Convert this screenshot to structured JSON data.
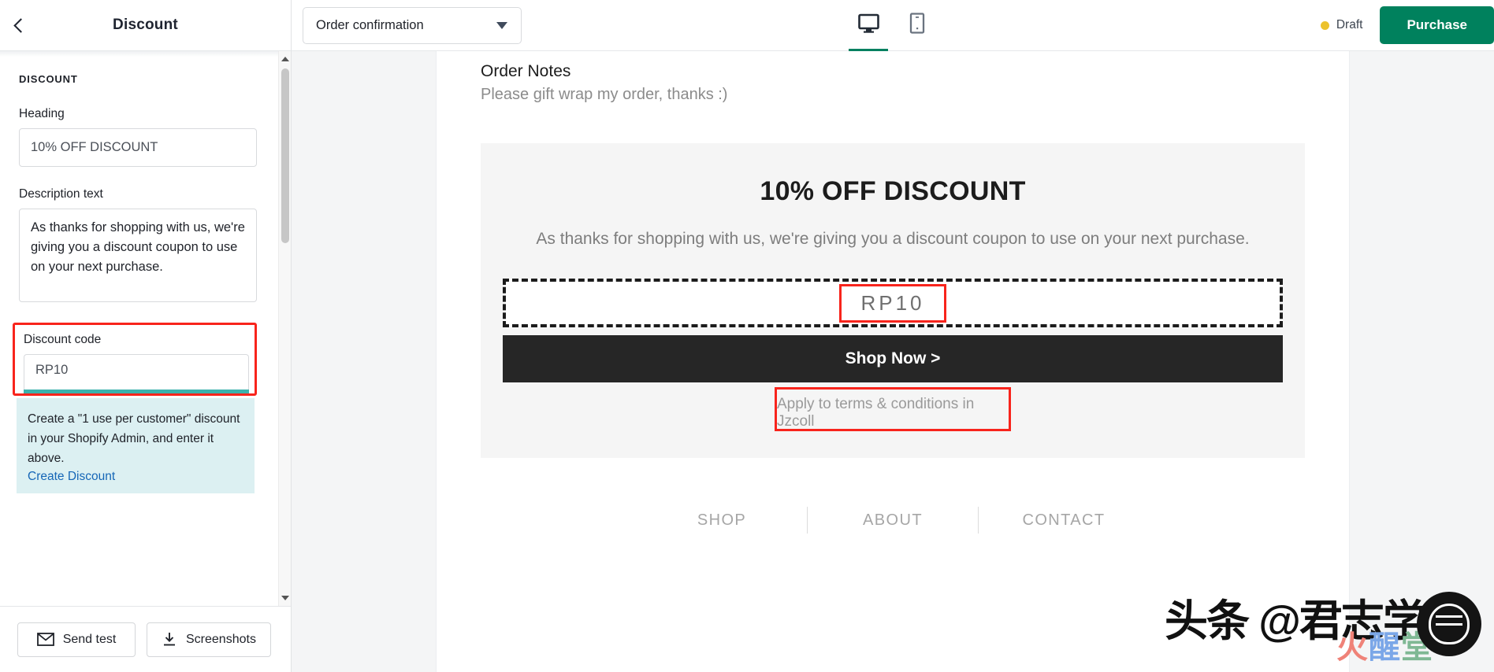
{
  "left_panel": {
    "back_icon": "chevron-left-icon",
    "title": "Discount",
    "section_label": "DISCOUNT",
    "heading_field": {
      "label": "Heading",
      "value": "10% OFF DISCOUNT"
    },
    "description_field": {
      "label": "Description text",
      "value": "As thanks for shopping with us, we're giving you a discount coupon to use on your next purchase."
    },
    "discount_code_field": {
      "label": "Discount code",
      "value": "RP10",
      "highlight_color": "#f8241c",
      "underline_color": "#3cb2ad"
    },
    "info_box": {
      "text": "Create a \"1 use per customer\" discount in your Shopify Admin, and enter it above.",
      "link_label": "Create Discount",
      "background": "#dcf0f2",
      "link_color": "#1566b7"
    },
    "footer": {
      "send_test_label": "Send test",
      "send_test_icon": "envelope-icon",
      "screenshots_label": "Screenshots",
      "screenshots_icon": "download-icon"
    }
  },
  "topbar": {
    "template_select": {
      "value": "Order confirmation",
      "caret_icon": "chevron-down-icon"
    },
    "device_tabs": [
      {
        "name": "desktop",
        "icon": "desktop-monitor-icon",
        "active": true
      },
      {
        "name": "mobile",
        "icon": "mobile-phone-icon",
        "active": false
      }
    ],
    "status": {
      "label": "Draft",
      "dot_color": "#ecc22c"
    },
    "purchase_button": {
      "label": "Purchase",
      "color": "#00815d"
    }
  },
  "preview": {
    "order_notes": {
      "title": "Order Notes",
      "body": "Please gift wrap my order, thanks :)"
    },
    "discount_block": {
      "heading": "10% OFF DISCOUNT",
      "description": "As thanks for shopping with us, we're giving you a discount coupon to use on your next purchase.",
      "coupon_code": "RP10",
      "shop_now_label": "Shop Now >",
      "terms_text": "Apply to terms & conditions in Jzcoll"
    },
    "footer_links": [
      "SHOP",
      "ABOUT",
      "CONTACT"
    ]
  },
  "watermark": {
    "main": "头条 @君志学堂",
    "sub_1": "火",
    "sub_2": "醒",
    "sub_3": "堂"
  }
}
